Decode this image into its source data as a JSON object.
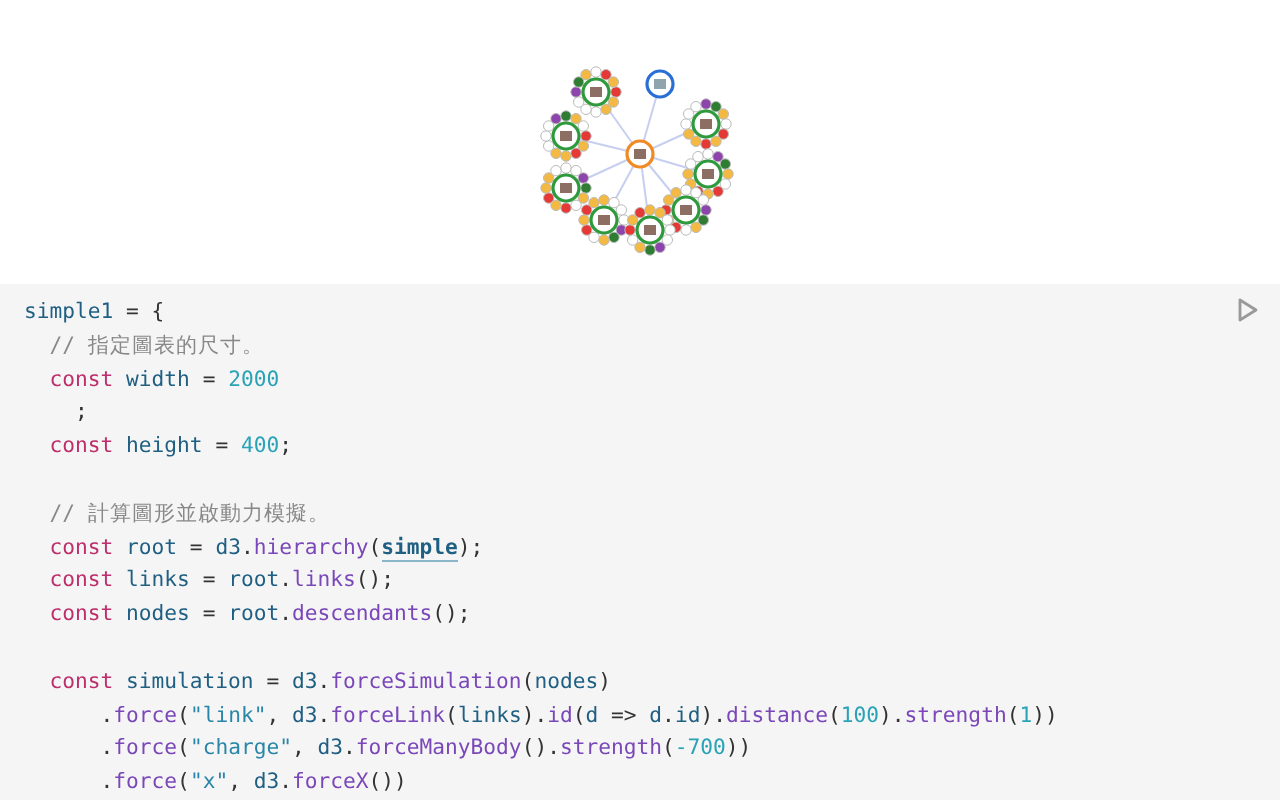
{
  "cell": {
    "code_lines": [
      {
        "kind": "code",
        "tokens": [
          {
            "kind": "variable",
            "text": "simple1"
          },
          {
            "kind": "plain",
            "text": " = {"
          }
        ]
      },
      {
        "kind": "code",
        "tokens": [
          {
            "kind": "comment",
            "text": "  // 指定圖表的尺寸。"
          }
        ]
      },
      {
        "kind": "code",
        "tokens": [
          {
            "kind": "keyword",
            "text": "  const"
          },
          {
            "kind": "variable",
            "text": " width"
          },
          {
            "kind": "plain",
            "text": " = "
          },
          {
            "kind": "number",
            "text": "2000"
          }
        ]
      },
      {
        "kind": "code",
        "tokens": [
          {
            "kind": "plain",
            "text": "    ;"
          }
        ]
      },
      {
        "kind": "code",
        "tokens": [
          {
            "kind": "keyword",
            "text": "  const"
          },
          {
            "kind": "variable",
            "text": " height"
          },
          {
            "kind": "plain",
            "text": " = "
          },
          {
            "kind": "number",
            "text": "400"
          },
          {
            "kind": "plain",
            "text": ";"
          }
        ]
      },
      {
        "kind": "blank"
      },
      {
        "kind": "code",
        "tokens": [
          {
            "kind": "comment",
            "text": "  // 計算圖形並啟動力模擬。"
          }
        ]
      },
      {
        "kind": "code",
        "tokens": [
          {
            "kind": "keyword",
            "text": "  const"
          },
          {
            "kind": "variable",
            "text": " root"
          },
          {
            "kind": "plain",
            "text": " = "
          },
          {
            "kind": "variable",
            "text": "d3"
          },
          {
            "kind": "plain",
            "text": "."
          },
          {
            "kind": "method",
            "text": "hierarchy"
          },
          {
            "kind": "plain",
            "text": "("
          },
          {
            "kind": "reference",
            "text": "simple"
          },
          {
            "kind": "plain",
            "text": ");"
          }
        ]
      },
      {
        "kind": "code",
        "tokens": [
          {
            "kind": "keyword",
            "text": "  const"
          },
          {
            "kind": "variable",
            "text": " links"
          },
          {
            "kind": "plain",
            "text": " = "
          },
          {
            "kind": "variable",
            "text": "root"
          },
          {
            "kind": "plain",
            "text": "."
          },
          {
            "kind": "method",
            "text": "links"
          },
          {
            "kind": "plain",
            "text": "();"
          }
        ]
      },
      {
        "kind": "code",
        "tokens": [
          {
            "kind": "keyword",
            "text": "  const"
          },
          {
            "kind": "variable",
            "text": " nodes"
          },
          {
            "kind": "plain",
            "text": " = "
          },
          {
            "kind": "variable",
            "text": "root"
          },
          {
            "kind": "plain",
            "text": "."
          },
          {
            "kind": "method",
            "text": "descendants"
          },
          {
            "kind": "plain",
            "text": "();"
          }
        ]
      },
      {
        "kind": "blank"
      },
      {
        "kind": "code",
        "tokens": [
          {
            "kind": "keyword",
            "text": "  const"
          },
          {
            "kind": "variable",
            "text": " simulation"
          },
          {
            "kind": "plain",
            "text": " = "
          },
          {
            "kind": "variable",
            "text": "d3"
          },
          {
            "kind": "plain",
            "text": "."
          },
          {
            "kind": "method",
            "text": "forceSimulation"
          },
          {
            "kind": "plain",
            "text": "("
          },
          {
            "kind": "variable",
            "text": "nodes"
          },
          {
            "kind": "plain",
            "text": ")"
          }
        ]
      },
      {
        "kind": "code",
        "tokens": [
          {
            "kind": "plain",
            "text": "      ."
          },
          {
            "kind": "method",
            "text": "force"
          },
          {
            "kind": "plain",
            "text": "("
          },
          {
            "kind": "string",
            "text": "\"link\""
          },
          {
            "kind": "plain",
            "text": ", "
          },
          {
            "kind": "variable",
            "text": "d3"
          },
          {
            "kind": "plain",
            "text": "."
          },
          {
            "kind": "method",
            "text": "forceLink"
          },
          {
            "kind": "plain",
            "text": "("
          },
          {
            "kind": "variable",
            "text": "links"
          },
          {
            "kind": "plain",
            "text": ")."
          },
          {
            "kind": "method",
            "text": "id"
          },
          {
            "kind": "plain",
            "text": "("
          },
          {
            "kind": "variable",
            "text": "d"
          },
          {
            "kind": "plain",
            "text": " => "
          },
          {
            "kind": "variable",
            "text": "d"
          },
          {
            "kind": "plain",
            "text": "."
          },
          {
            "kind": "variable",
            "text": "id"
          },
          {
            "kind": "plain",
            "text": ")."
          },
          {
            "kind": "method",
            "text": "distance"
          },
          {
            "kind": "plain",
            "text": "("
          },
          {
            "kind": "number",
            "text": "100"
          },
          {
            "kind": "plain",
            "text": ")."
          },
          {
            "kind": "method",
            "text": "strength"
          },
          {
            "kind": "plain",
            "text": "("
          },
          {
            "kind": "number",
            "text": "1"
          },
          {
            "kind": "plain",
            "text": "))"
          }
        ]
      },
      {
        "kind": "code",
        "tokens": [
          {
            "kind": "plain",
            "text": "      ."
          },
          {
            "kind": "method",
            "text": "force"
          },
          {
            "kind": "plain",
            "text": "("
          },
          {
            "kind": "string",
            "text": "\"charge\""
          },
          {
            "kind": "plain",
            "text": ", "
          },
          {
            "kind": "variable",
            "text": "d3"
          },
          {
            "kind": "plain",
            "text": "."
          },
          {
            "kind": "method",
            "text": "forceManyBody"
          },
          {
            "kind": "plain",
            "text": "()."
          },
          {
            "kind": "method",
            "text": "strength"
          },
          {
            "kind": "plain",
            "text": "("
          },
          {
            "kind": "number",
            "text": "-700"
          },
          {
            "kind": "plain",
            "text": "))"
          }
        ]
      },
      {
        "kind": "code",
        "tokens": [
          {
            "kind": "plain",
            "text": "      ."
          },
          {
            "kind": "method",
            "text": "force"
          },
          {
            "kind": "plain",
            "text": "("
          },
          {
            "kind": "string",
            "text": "\"x\""
          },
          {
            "kind": "plain",
            "text": ", "
          },
          {
            "kind": "variable",
            "text": "d3"
          },
          {
            "kind": "plain",
            "text": "."
          },
          {
            "kind": "method",
            "text": "forceX"
          },
          {
            "kind": "plain",
            "text": "())"
          }
        ]
      }
    ]
  }
}
